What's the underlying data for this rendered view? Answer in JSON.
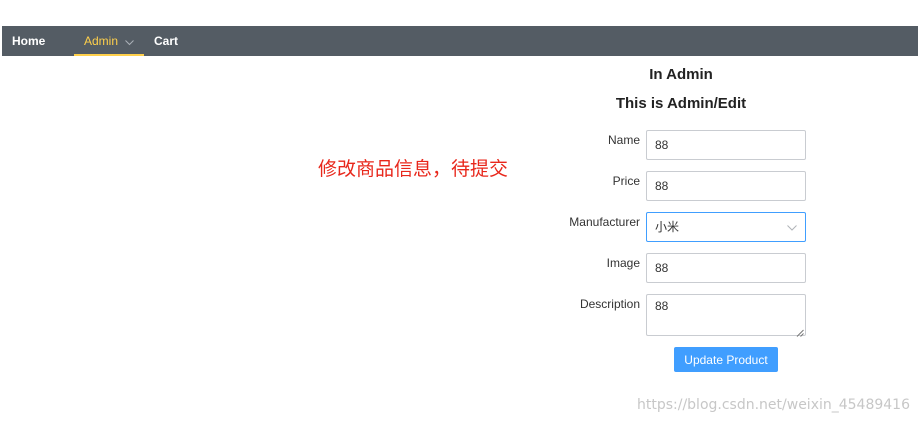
{
  "nav": {
    "home": "Home",
    "admin": "Admin",
    "cart": "Cart",
    "active_color": "#ffd04b",
    "bg_color": "#545c64"
  },
  "headings": {
    "in_admin": "In Admin",
    "edit": "This is Admin/Edit"
  },
  "annotation": "修改商品信息，待提交",
  "form": {
    "name": {
      "label": "Name",
      "value": "88"
    },
    "price": {
      "label": "Price",
      "value": "88"
    },
    "manufacturer": {
      "label": "Manufacturer",
      "value": "小米"
    },
    "image": {
      "label": "Image",
      "value": "88"
    },
    "description": {
      "label": "Description",
      "value": "88"
    },
    "submit_label": "Update Product",
    "accent_color": "#409eff"
  },
  "watermark": "https://blog.csdn.net/weixin_45489416"
}
